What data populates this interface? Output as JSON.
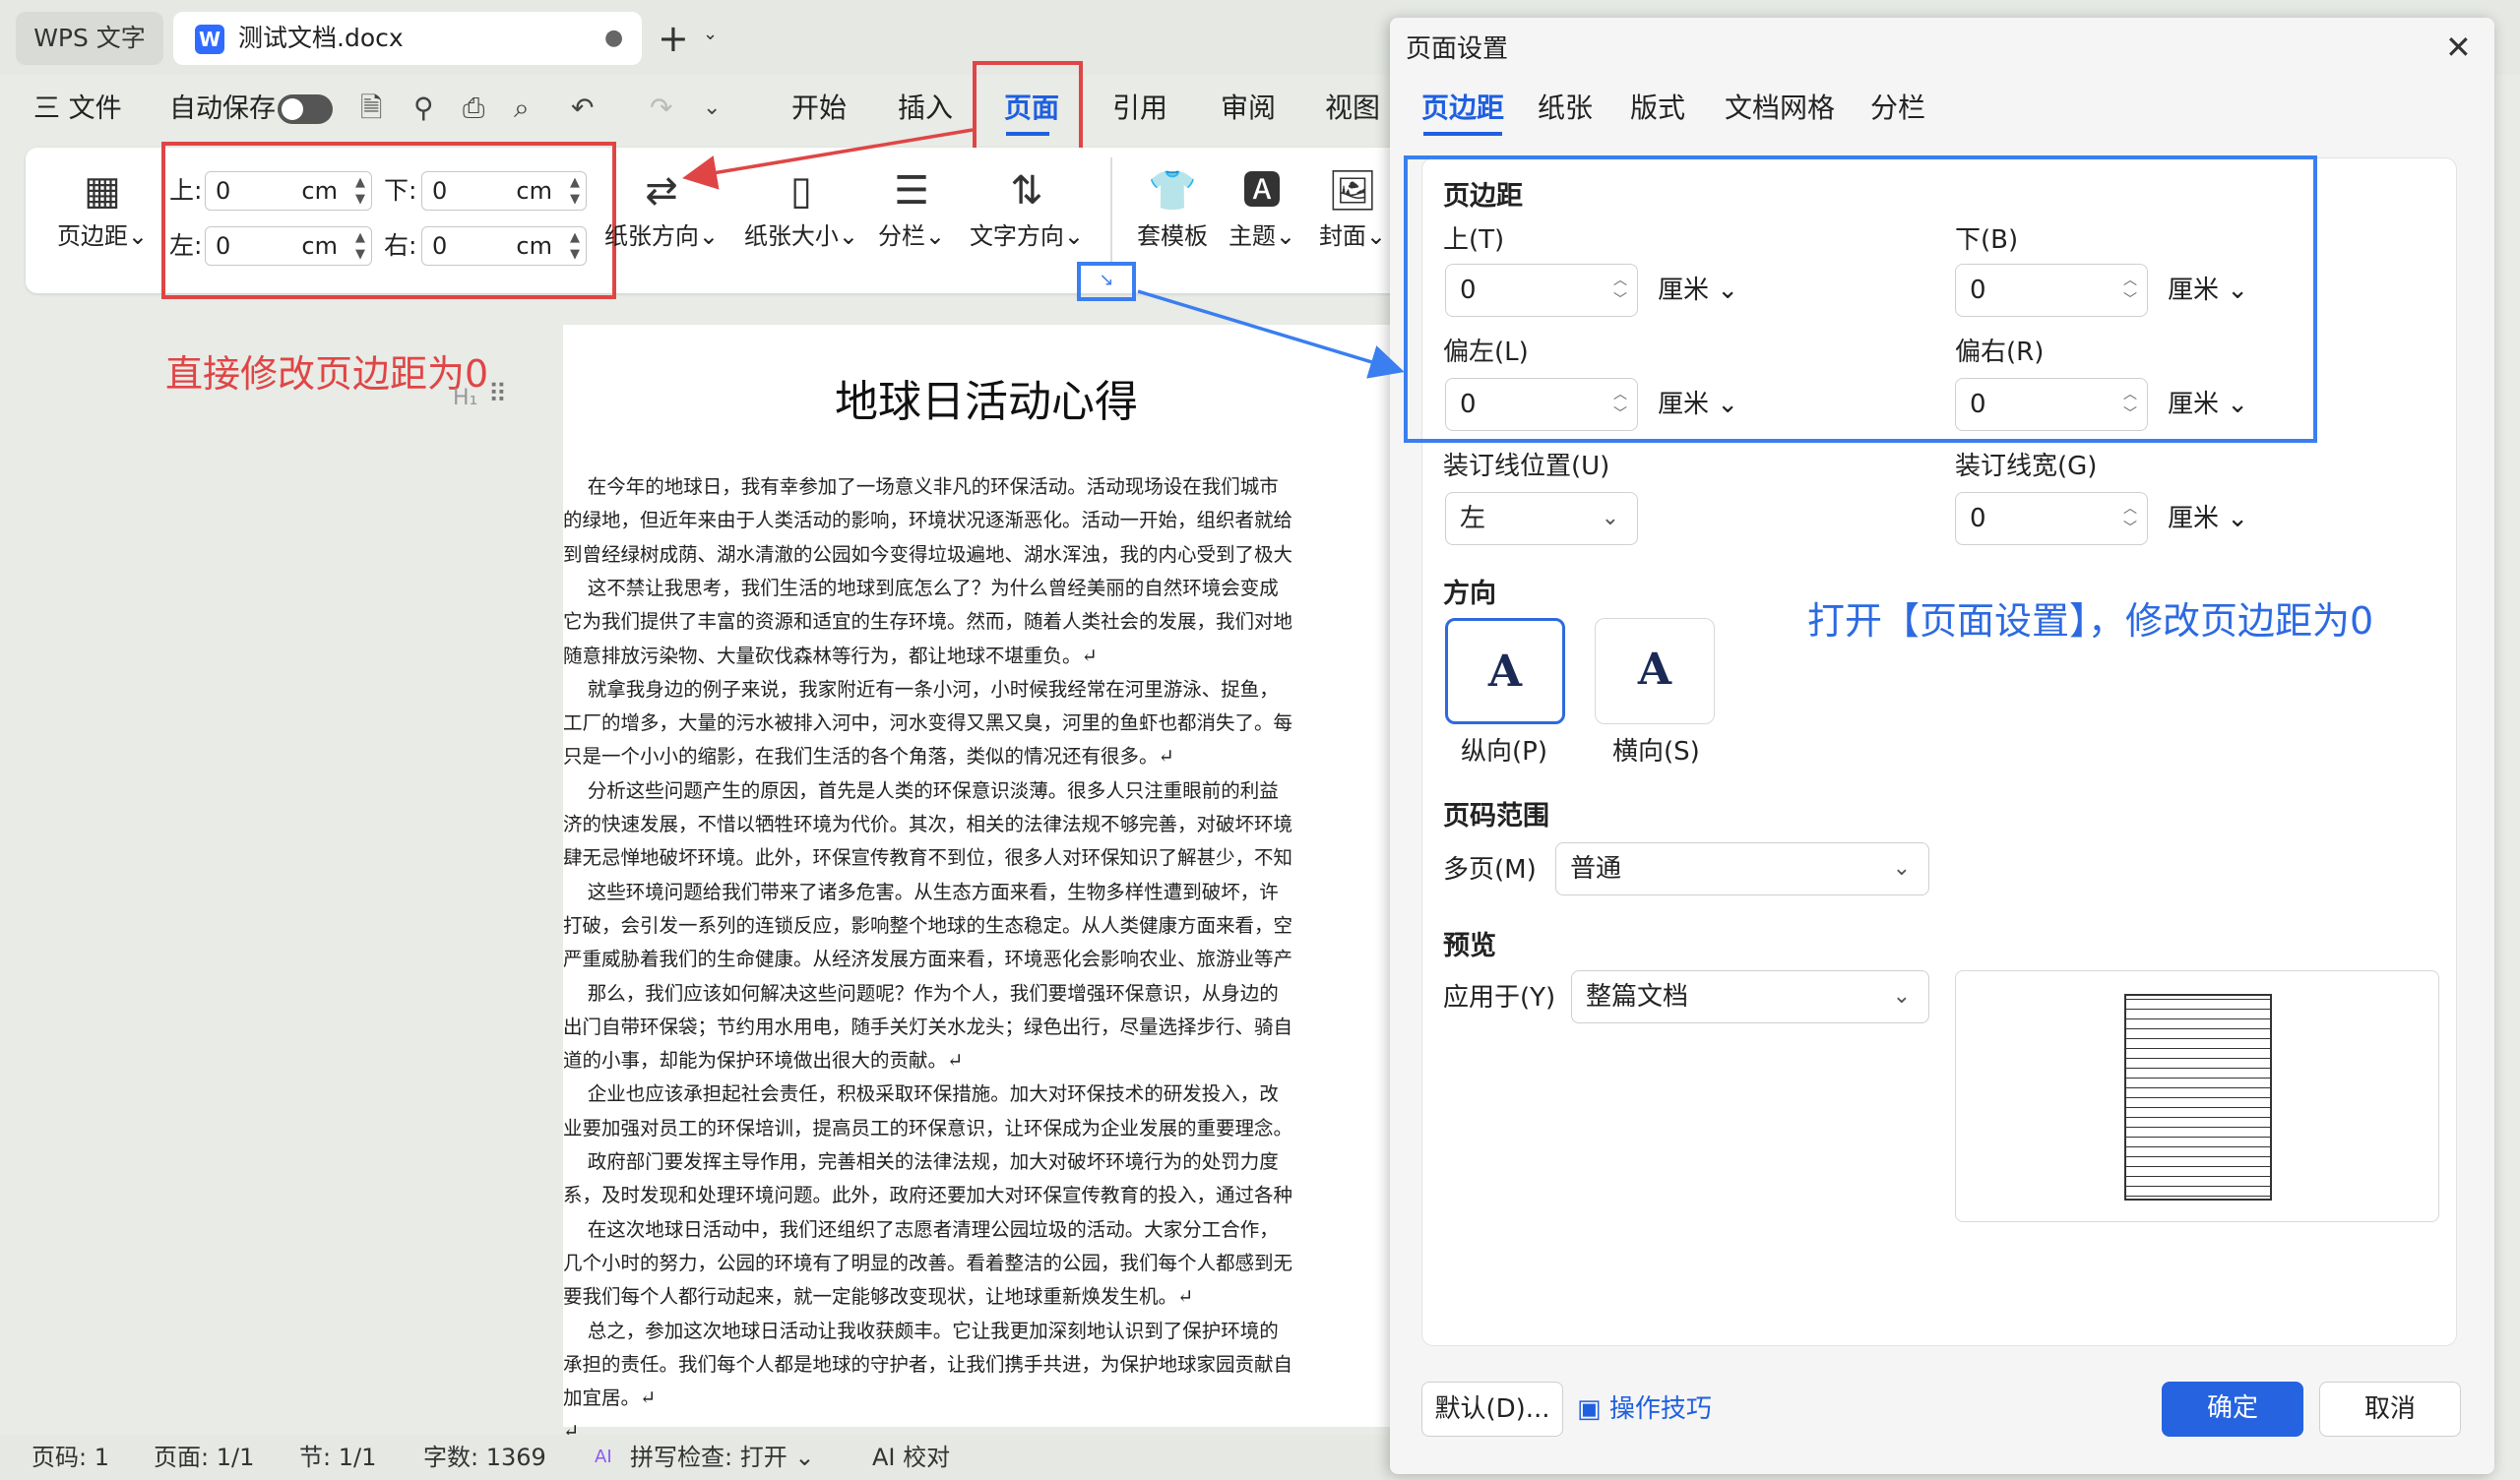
{
  "titlebar": {
    "app_tab": "WPS 文字",
    "doc_tab": "测试文档.docx",
    "modified_dot": "●",
    "new_tab": "+",
    "tab_menu": "⌄",
    "word_icon": "W"
  },
  "menu": {
    "file": "三  文件",
    "autosave": "自动保存",
    "tabs": [
      "开始",
      "插入",
      "页面",
      "引用",
      "审阅",
      "视图"
    ],
    "active_tab": "页面"
  },
  "ribbon": {
    "margins_btn": "页边距⌄",
    "top_label": "上:",
    "bottom_label": "下:",
    "left_label": "左:",
    "right_label": "右:",
    "top_value": "0",
    "bottom_value": "0",
    "left_value": "0",
    "right_value": "0",
    "unit": "cm",
    "orientation": "纸张方向⌄",
    "size": "纸张大小⌄",
    "columns": "分栏⌄",
    "text_dir": "文字方向⌄",
    "template": "套模板",
    "theme": "主题⌄",
    "cover": "封面⌄"
  },
  "annotations": {
    "red_note": "直接修改页边距为0",
    "blue_note": "打开【页面设置】，修改页边距为0"
  },
  "document": {
    "title": "地球日活动心得",
    "h_mark": "H₁",
    "lines": [
      "    在今年的地球日，我有幸参加了一场意义非凡的环保活动。活动现场设在我们城市",
      "的绿地，但近年来由于人类活动的影响，环境状况逐渐恶化。活动一开始，组织者就给",
      "到曾经绿树成荫、湖水清澈的公园如今变得垃圾遍地、湖水浑浊，我的内心受到了极大",
      "    这不禁让我思考，我们生活的地球到底怎么了？为什么曾经美丽的自然环境会变成",
      "它为我们提供了丰富的资源和适宜的生存环境。然而，随着人类社会的发展，我们对地",
      "随意排放污染物、大量砍伐森林等行为，都让地球不堪重负。↵",
      "    就拿我身边的例子来说，我家附近有一条小河，小时候我经常在河里游泳、捉鱼，",
      "工厂的增多，大量的污水被排入河中，河水变得又黑又臭，河里的鱼虾也都消失了。每",
      "只是一个小小的缩影，在我们生活的各个角落，类似的情况还有很多。↵",
      "    分析这些问题产生的原因，首先是人类的环保意识淡薄。很多人只注重眼前的利益",
      "济的快速发展，不惜以牺牲环境为代价。其次，相关的法律法规不够完善，对破坏环境",
      "肆无忌惮地破坏环境。此外，环保宣传教育不到位，很多人对环保知识了解甚少，不知",
      "    这些环境问题给我们带来了诸多危害。从生态方面来看，生物多样性遭到破坏，许",
      "打破，会引发一系列的连锁反应，影响整个地球的生态稳定。从人类健康方面来看，空",
      "严重威胁着我们的生命健康。从经济发展方面来看，环境恶化会影响农业、旅游业等产",
      "    那么，我们应该如何解决这些问题呢？作为个人，我们要增强环保意识，从身边的",
      "出门自带环保袋；节约用水用电，随手关灯关水龙头；绿色出行，尽量选择步行、骑自",
      "道的小事，却能为保护环境做出很大的贡献。↵",
      "    企业也应该承担起社会责任，积极采取环保措施。加大对环保技术的研发投入，改",
      "业要加强对员工的环保培训，提高员工的环保意识，让环保成为企业发展的重要理念。",
      "    政府部门要发挥主导作用，完善相关的法律法规，加大对破坏环境行为的处罚力度",
      "系，及时发现和处理环境问题。此外，政府还要加大对环保宣传教育的投入，通过各种",
      "    在这次地球日活动中，我们还组织了志愿者清理公园垃圾的活动。大家分工合作，",
      "几个小时的努力，公园的环境有了明显的改善。看着整洁的公园，我们每个人都感到无",
      "要我们每个人都行动起来，就一定能够改变现状，让地球重新焕发生机。↵",
      "    总之，参加这次地球日活动让我收获颇丰。它让我更加深刻地认识到了保护环境的",
      "承担的责任。我们每个人都是地球的守护者，让我们携手共进，为保护地球家园贡献自",
      "加宜居。↵",
      "↵"
    ]
  },
  "status": {
    "page_code": "页码: 1",
    "pages": "页面: 1/1",
    "section": "节: 1/1",
    "words": "字数: 1369",
    "spell": "拼写检查: 打开 ⌄",
    "ai_check": "AI 校对",
    "ai_badge": "AI"
  },
  "dialog": {
    "title": "页面设置",
    "close": "✕",
    "tabs": [
      "页边距",
      "纸张",
      "版式",
      "文档网格",
      "分栏"
    ],
    "margins_section": "页边距",
    "top_label": "上(T)",
    "bottom_label": "下(B)",
    "left_label": "偏左(L)",
    "right_label": "偏右(R)",
    "top": "0",
    "bottom": "0",
    "left": "0",
    "right": "0",
    "unit": "厘米",
    "gutter_pos_label": "装订线位置(U)",
    "gutter_pos": "左",
    "gutter_width_label": "装订线宽(G)",
    "gutter_width": "0",
    "orientation_section": "方向",
    "portrait": "纵向(P)",
    "landscape": "横向(S)",
    "orient_glyph": "A",
    "page_range_section": "页码范围",
    "multi_label": "多页(M)",
    "multi_value": "普通",
    "preview_section": "预览",
    "apply_label": "应用于(Y)",
    "apply_value": "整篇文档",
    "default_btn": "默认(D)...",
    "tips": "操作技巧",
    "ok": "确定",
    "cancel": "取消"
  },
  "colors": {
    "accent": "#1f5fe0",
    "red_annotation": "#e04545",
    "blue_annotation": "#3a7ef0",
    "ok_button": "#2563e0"
  }
}
